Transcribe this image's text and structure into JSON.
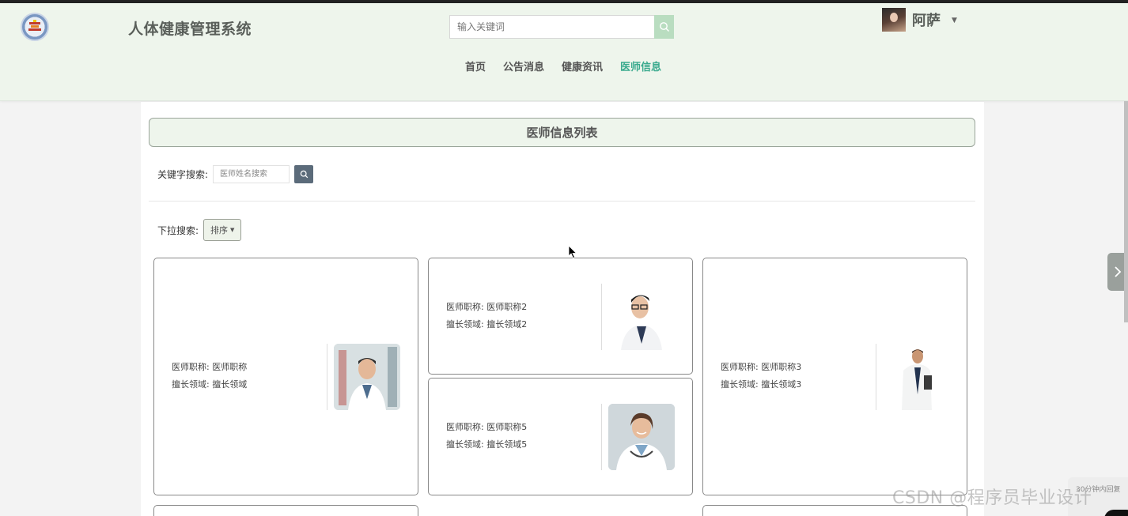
{
  "app": {
    "title": "人体健康管理系统"
  },
  "header": {
    "search_placeholder": "输入关键词",
    "user_name": "阿萨",
    "nav": [
      {
        "label": "首页",
        "active": false
      },
      {
        "label": "公告消息",
        "active": false
      },
      {
        "label": "健康资讯",
        "active": false
      },
      {
        "label": "医师信息",
        "active": true
      }
    ]
  },
  "main": {
    "list_title": "医师信息列表",
    "keyword_label": "关键字搜索:",
    "keyword_placeholder": "医师姓名搜索",
    "dropdown_label": "下拉搜索:",
    "sort_label": "排序"
  },
  "doctors": [
    {
      "title_label": "医师职称: 医师职称",
      "field_label": "擅长领域: 擅长领域",
      "icon": "doctor-photo-1"
    },
    {
      "title_label": "医师职称: 医师职称2",
      "field_label": "擅长领域: 擅长领域2",
      "icon": "doctor-photo-2"
    },
    {
      "title_label": "医师职称: 医师职称3",
      "field_label": "擅长领域: 擅长领域3",
      "icon": "doctor-photo-3"
    },
    {
      "title_label": "医师职称: 医师职称5",
      "field_label": "擅长领域: 擅长领域5",
      "icon": "doctor-photo-5"
    }
  ],
  "watermark": "CSDN @程序员毕业设计",
  "corner_badge": "30分钟内回复"
}
